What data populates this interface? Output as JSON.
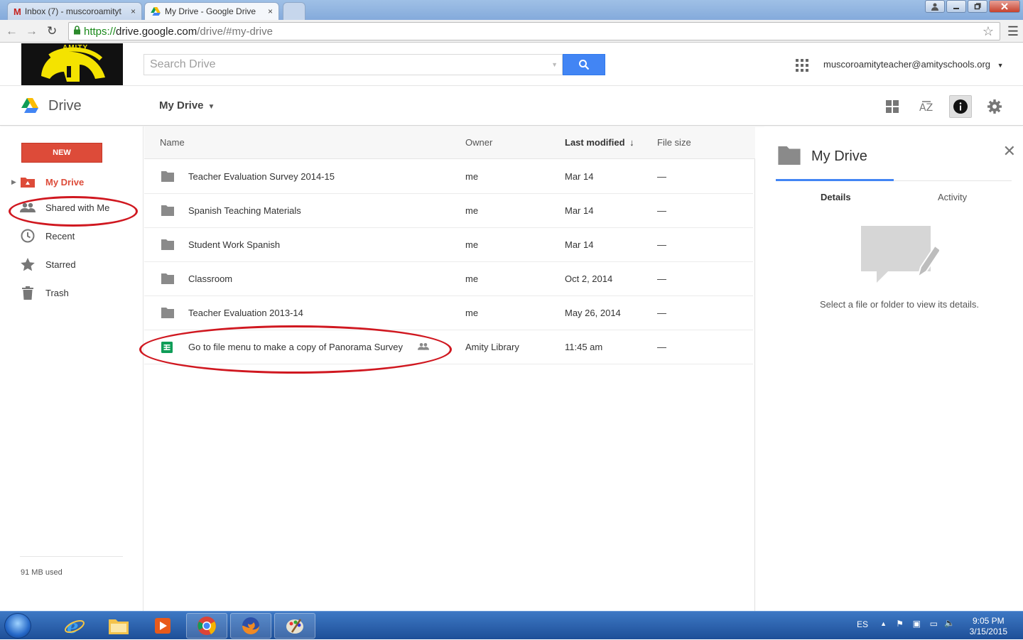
{
  "browser": {
    "tabs": [
      {
        "label": "Inbox (7) - muscoroamityt",
        "close": "×"
      },
      {
        "label": "My Drive - Google Drive",
        "close": "×"
      }
    ],
    "url_scheme": "https://",
    "url_host": "drive.google.com",
    "url_path": "/drive/#my-drive"
  },
  "header": {
    "logo_text": "AMITY",
    "search_placeholder": "Search Drive",
    "account": "muscoroamityteacher@amityschools.org"
  },
  "toolbar": {
    "app_name": "Drive",
    "breadcrumb": "My Drive"
  },
  "sidebar": {
    "new_label": "NEW",
    "items": [
      {
        "label": "My Drive"
      },
      {
        "label": "Shared with Me"
      },
      {
        "label": "Recent"
      },
      {
        "label": "Starred"
      },
      {
        "label": "Trash"
      }
    ],
    "storage": "91 MB used"
  },
  "list": {
    "columns": {
      "name": "Name",
      "owner": "Owner",
      "modified": "Last modified",
      "sort_arrow": "↓",
      "size": "File size"
    },
    "rows": [
      {
        "name": "Teacher Evaluation Survey 2014-15",
        "owner": "me",
        "modified": "Mar 14",
        "size": "—"
      },
      {
        "name": "Spanish Teaching Materials",
        "owner": "me",
        "modified": "Mar 14",
        "size": "—"
      },
      {
        "name": "Student Work Spanish",
        "owner": "me",
        "modified": "Mar 14",
        "size": "—"
      },
      {
        "name": "Classroom",
        "owner": "me",
        "modified": "Oct 2, 2014",
        "size": "—"
      },
      {
        "name": "Teacher Evaluation 2013-14",
        "owner": "me",
        "modified": "May 26, 2014",
        "size": "—"
      },
      {
        "name": "Go to file menu to make a copy of Panorama Survey",
        "owner": "Amity Library",
        "modified": "11:45 am",
        "size": "—"
      }
    ]
  },
  "details": {
    "title": "My Drive",
    "tabs": [
      "Details",
      "Activity"
    ],
    "message": "Select a file or folder to view its details."
  },
  "taskbar": {
    "lang": "ES",
    "time": "9:05 PM",
    "date": "3/15/2015"
  },
  "colors": {
    "accent_red": "#dd4b39",
    "accent_blue": "#4285f4",
    "annotation_red": "#d01820"
  }
}
